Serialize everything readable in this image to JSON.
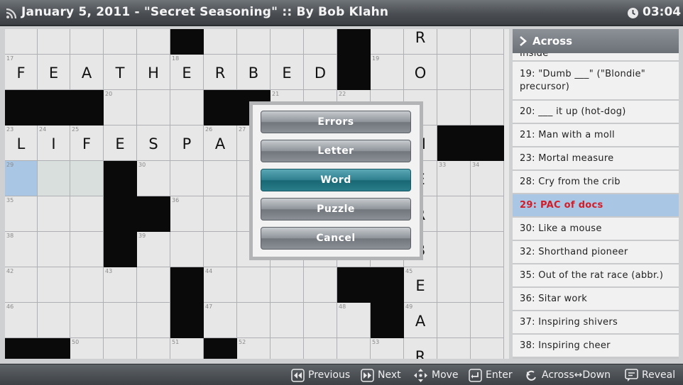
{
  "header": {
    "title": "January 5, 2011 - \"Secret Seasoning\" :: By Bob Klahn",
    "timer": "03:04",
    "rss_icon": "rss-icon",
    "clock_icon": "clock-icon"
  },
  "grid": {
    "cols": 15,
    "rows": [
      [
        {
          "t": "w"
        },
        {
          "t": "w"
        },
        {
          "t": "w"
        },
        {
          "t": "w"
        },
        {
          "t": "w"
        },
        {
          "t": "b"
        },
        {
          "t": "w"
        },
        {
          "t": "w"
        },
        {
          "t": "w"
        },
        {
          "t": "w"
        },
        {
          "t": "b"
        },
        {
          "t": "w"
        },
        {
          "t": "w",
          "l": "R"
        },
        {
          "t": "w"
        },
        {
          "t": "w"
        }
      ],
      [
        {
          "t": "w",
          "n": "17",
          "l": "F"
        },
        {
          "t": "w",
          "l": "E"
        },
        {
          "t": "w",
          "l": "A"
        },
        {
          "t": "w",
          "l": "T"
        },
        {
          "t": "w",
          "l": "H"
        },
        {
          "t": "w",
          "n": "18",
          "l": "E"
        },
        {
          "t": "w",
          "l": "R"
        },
        {
          "t": "w",
          "l": "B"
        },
        {
          "t": "w",
          "l": "E"
        },
        {
          "t": "w",
          "l": "D"
        },
        {
          "t": "b"
        },
        {
          "t": "w",
          "n": "19"
        },
        {
          "t": "w",
          "l": "O"
        },
        {
          "t": "w"
        },
        {
          "t": "w"
        }
      ],
      [
        {
          "t": "b"
        },
        {
          "t": "b"
        },
        {
          "t": "b"
        },
        {
          "t": "w",
          "n": "20"
        },
        {
          "t": "w"
        },
        {
          "t": "w"
        },
        {
          "t": "b"
        },
        {
          "t": "b"
        },
        {
          "t": "w",
          "n": "21"
        },
        {
          "t": "w"
        },
        {
          "t": "w",
          "n": "22"
        },
        {
          "t": "w"
        },
        {
          "t": "w"
        },
        {
          "t": "w"
        },
        {
          "t": "w"
        }
      ],
      [
        {
          "t": "w",
          "n": "23",
          "l": "L"
        },
        {
          "t": "w",
          "n": "24",
          "l": "I"
        },
        {
          "t": "w",
          "n": "25",
          "l": "F"
        },
        {
          "t": "w",
          "l": "E"
        },
        {
          "t": "w",
          "l": "S"
        },
        {
          "t": "w",
          "l": "P"
        },
        {
          "t": "w",
          "n": "26",
          "l": "A"
        },
        {
          "t": "w",
          "n": "27"
        },
        {
          "t": "w"
        },
        {
          "t": "w"
        },
        {
          "t": "w"
        },
        {
          "t": "w"
        },
        {
          "t": "w",
          "l": "H"
        },
        {
          "t": "b"
        },
        {
          "t": "b"
        }
      ],
      [
        {
          "t": "sel",
          "n": "29"
        },
        {
          "t": "word"
        },
        {
          "t": "word"
        },
        {
          "t": "b"
        },
        {
          "t": "w",
          "n": "30"
        },
        {
          "t": "w"
        },
        {
          "t": "w"
        },
        {
          "t": "w"
        },
        {
          "t": "w"
        },
        {
          "t": "w"
        },
        {
          "t": "w"
        },
        {
          "t": "w"
        },
        {
          "t": "w",
          "l": "E"
        },
        {
          "t": "w",
          "n": "33"
        },
        {
          "t": "w",
          "n": "34"
        }
      ],
      [
        {
          "t": "w",
          "n": "35"
        },
        {
          "t": "w"
        },
        {
          "t": "w"
        },
        {
          "t": "b"
        },
        {
          "t": "b"
        },
        {
          "t": "w",
          "n": "36"
        },
        {
          "t": "w"
        },
        {
          "t": "w"
        },
        {
          "t": "w"
        },
        {
          "t": "w"
        },
        {
          "t": "w"
        },
        {
          "t": "w"
        },
        {
          "t": "w",
          "l": "R"
        },
        {
          "t": "w"
        },
        {
          "t": "w"
        }
      ],
      [
        {
          "t": "w",
          "n": "38"
        },
        {
          "t": "w"
        },
        {
          "t": "w"
        },
        {
          "t": "b"
        },
        {
          "t": "w",
          "n": "39"
        },
        {
          "t": "w"
        },
        {
          "t": "w"
        },
        {
          "t": "w"
        },
        {
          "t": "w"
        },
        {
          "t": "w"
        },
        {
          "t": "w"
        },
        {
          "t": "w"
        },
        {
          "t": "w",
          "l": "B"
        },
        {
          "t": "w"
        },
        {
          "t": "w"
        }
      ],
      [
        {
          "t": "w",
          "n": "42"
        },
        {
          "t": "w"
        },
        {
          "t": "w"
        },
        {
          "t": "w",
          "n": "43"
        },
        {
          "t": "w"
        },
        {
          "t": "b"
        },
        {
          "t": "w",
          "n": "44"
        },
        {
          "t": "w"
        },
        {
          "t": "w"
        },
        {
          "t": "w"
        },
        {
          "t": "b"
        },
        {
          "t": "b"
        },
        {
          "t": "w",
          "n": "45",
          "l": "E"
        },
        {
          "t": "w"
        },
        {
          "t": "w"
        }
      ],
      [
        {
          "t": "w",
          "n": "46"
        },
        {
          "t": "w"
        },
        {
          "t": "w"
        },
        {
          "t": "w"
        },
        {
          "t": "w"
        },
        {
          "t": "b"
        },
        {
          "t": "w",
          "n": "47"
        },
        {
          "t": "w"
        },
        {
          "t": "w"
        },
        {
          "t": "w"
        },
        {
          "t": "w",
          "n": "48"
        },
        {
          "t": "b"
        },
        {
          "t": "w",
          "n": "49",
          "l": "A"
        },
        {
          "t": "w"
        },
        {
          "t": "w"
        }
      ],
      [
        {
          "t": "b"
        },
        {
          "t": "b"
        },
        {
          "t": "w",
          "n": "50"
        },
        {
          "t": "w"
        },
        {
          "t": "w"
        },
        {
          "t": "w",
          "n": "51"
        },
        {
          "t": "b"
        },
        {
          "t": "w",
          "n": "52"
        },
        {
          "t": "w"
        },
        {
          "t": "w"
        },
        {
          "t": "w"
        },
        {
          "t": "w",
          "n": "53"
        },
        {
          "t": "w",
          "l": "R"
        },
        {
          "t": "w"
        },
        {
          "t": "w"
        }
      ]
    ]
  },
  "clues": {
    "title": "Across",
    "items": [
      {
        "text": "Inside",
        "active": false
      },
      {
        "text": "19: \"Dumb ___\" (\"Blondie\" precursor)",
        "active": false
      },
      {
        "text": "20: ___ it up (hot-dog)",
        "active": false
      },
      {
        "text": "21: Man with a moll",
        "active": false
      },
      {
        "text": "23: Mortal measure",
        "active": false
      },
      {
        "text": "28: Cry from the crib",
        "active": false
      },
      {
        "text": "29: PAC of docs",
        "active": true
      },
      {
        "text": "30: Like a mouse",
        "active": false
      },
      {
        "text": "32: Shorthand pioneer",
        "active": false
      },
      {
        "text": "35: Out of the rat race (abbr.)",
        "active": false
      },
      {
        "text": "36: Sitar work",
        "active": false
      },
      {
        "text": "37: Inspiring shivers",
        "active": false
      },
      {
        "text": "38: Inspiring cheer",
        "active": false
      }
    ]
  },
  "dialog": {
    "buttons": [
      "Errors",
      "Letter",
      "Word",
      "Puzzle",
      "Cancel"
    ],
    "highlighted": "Word"
  },
  "footer": [
    {
      "icon": "rewind-icon",
      "label": "Previous"
    },
    {
      "icon": "fast-forward-icon",
      "label": "Next"
    },
    {
      "icon": "move-arrows-icon",
      "label": "Move"
    },
    {
      "icon": "enter-icon",
      "label": "Enter"
    },
    {
      "icon": "rotate-icon",
      "label": "Across↔Down"
    },
    {
      "icon": "reveal-icon",
      "label": "Reveal"
    }
  ],
  "colors": {
    "selected_cell": "#a9c7e4",
    "active_clue_text": "#d41b26",
    "dialog_highlight": "#2e7f8f"
  }
}
